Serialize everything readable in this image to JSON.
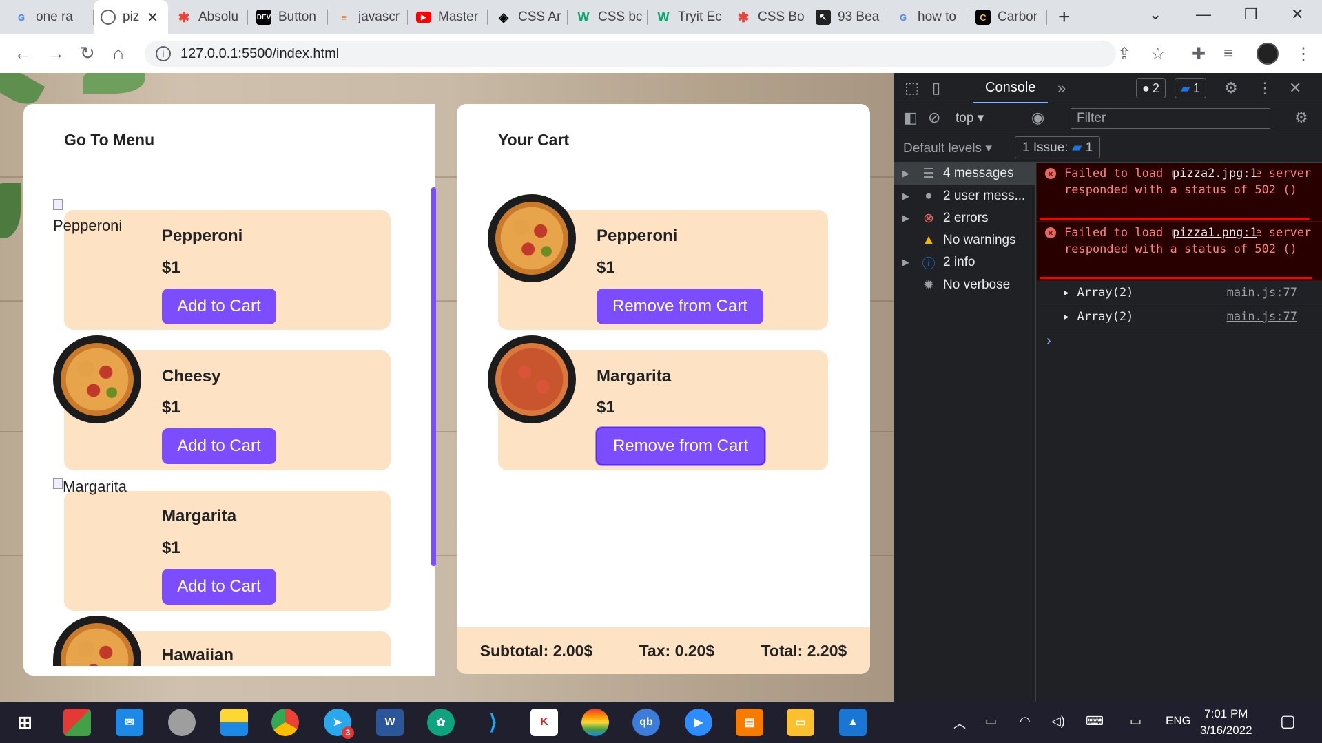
{
  "browser": {
    "tabs": [
      {
        "label": "one ra",
        "icon": "google-icon",
        "color": "#4285f4"
      },
      {
        "label": "piz",
        "icon": "globe-icon",
        "color": "#5f6368",
        "active": true
      },
      {
        "label": "Absolu",
        "icon": "asterisk-icon",
        "color": "#e8453c"
      },
      {
        "label": "Button",
        "icon": "dev-icon",
        "color": "#000000"
      },
      {
        "label": "javascr",
        "icon": "stackoverflow-icon",
        "color": "#f48024"
      },
      {
        "label": "Master",
        "icon": "youtube-icon",
        "color": "#ff0000"
      },
      {
        "label": "CSS Ar",
        "icon": "codepen-icon",
        "color": "#000000"
      },
      {
        "label": "CSS bc",
        "icon": "w3schools-icon",
        "color": "#04aa6d"
      },
      {
        "label": "Tryit Ec",
        "icon": "w3schools-icon",
        "color": "#04aa6d"
      },
      {
        "label": "CSS Bo",
        "icon": "asterisk-icon",
        "color": "#e8453c"
      },
      {
        "label": "93 Bea",
        "icon": "cursor-icon",
        "color": "#222222"
      },
      {
        "label": "how to",
        "icon": "google-icon",
        "color": "#4285f4"
      },
      {
        "label": "Carbor",
        "icon": "carbon-icon",
        "color": "#000000"
      }
    ],
    "url": "127.0.0.1:5500/index.html"
  },
  "menu": {
    "title": "Go To Menu",
    "items": [
      {
        "name": "Pepperoni",
        "price": "$1",
        "button": "Add to Cart",
        "alt": "Pepperoni"
      },
      {
        "name": "Cheesy",
        "price": "$1",
        "button": "Add to Cart"
      },
      {
        "name": "Margarita",
        "price": "$1",
        "button": "Add to Cart",
        "alt": "Margarita"
      },
      {
        "name": "Hawaiian"
      }
    ]
  },
  "cart": {
    "title": "Your Cart",
    "items": [
      {
        "name": "Pepperoni",
        "price": "$1",
        "button": "Remove from Cart"
      },
      {
        "name": "Margarita",
        "price": "$1",
        "button": "Remove from Cart"
      }
    ],
    "subtotal": "Subtotal: 2.00$",
    "tax": "Tax: 0.20$",
    "total": "Total: 2.20$"
  },
  "devtools": {
    "tab": "Console",
    "error_badge": "2",
    "issue_badge": "1",
    "context": "top",
    "filter_placeholder": "Filter",
    "levels": "Default levels",
    "issues": "1 Issue:",
    "issues_count": "1",
    "sidebar": [
      {
        "label": "4 messages"
      },
      {
        "label": "2 user mess..."
      },
      {
        "label": "2 errors"
      },
      {
        "label": "No warnings"
      },
      {
        "label": "2 info"
      },
      {
        "label": "No verbose"
      }
    ],
    "errors": [
      {
        "text": "Failed to load resource: the server responded with a status of 502 ()",
        "source": "pizza2.jpg:1"
      },
      {
        "text": "Failed to load resource: the server responded with a status of 502 ()",
        "source": "pizza1.png:1"
      }
    ],
    "logs": [
      {
        "value": "Array(2)",
        "source": "main.js:77"
      },
      {
        "value": "Array(2)",
        "source": "main.js:77"
      }
    ]
  },
  "taskbar": {
    "lang": "ENG",
    "time": "7:01 PM",
    "date": "3/16/2022",
    "telegram_badge": "3"
  }
}
